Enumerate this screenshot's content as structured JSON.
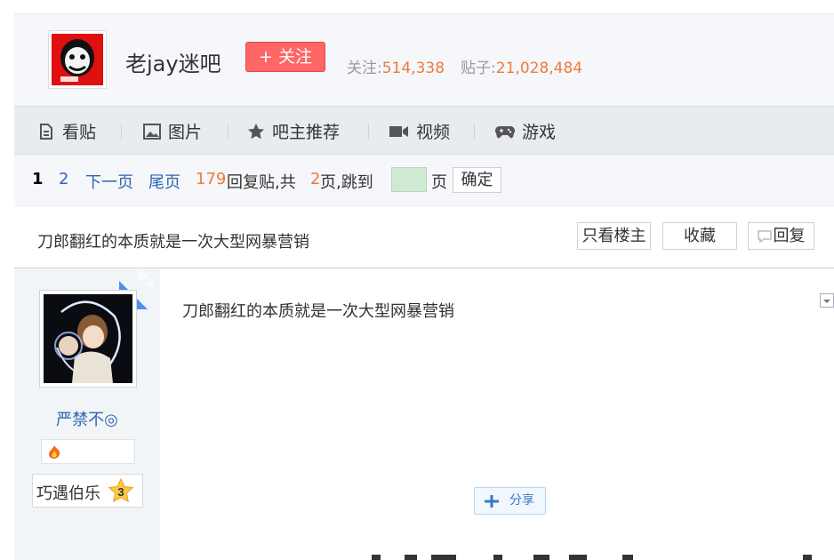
{
  "header": {
    "bar_name": "老jay迷吧",
    "follow_label": "+ 关注",
    "follow_count_label": "关注:",
    "follow_count": "514,338",
    "post_count_label": "贴子:",
    "post_count": "21,028,484"
  },
  "nav": {
    "items": [
      "看贴",
      "图片",
      "吧主推荐",
      "视频",
      "游戏"
    ]
  },
  "pager": {
    "current_page": "1",
    "page_2": "2",
    "next_label": "下一页",
    "last_label": "尾页",
    "reply_count": "179",
    "reply_suffix": "回复贴,共",
    "total_pages": "2",
    "pages_suffix": "页,跳到",
    "page_unit": "页",
    "confirm_label": "确定"
  },
  "thread": {
    "title": "刀郎翻红的本质就是一次大型网暴营销",
    "only_op_label": "只看楼主",
    "favorite_label": "收藏",
    "reply_label": "回复"
  },
  "post": {
    "op_tag": "楼主",
    "author_name": "严禁不◎",
    "level_title": "巧遇伯乐",
    "level_number": "3",
    "content": "刀郎翻红的本质就是一次大型网暴营销",
    "share_label": "分享"
  },
  "colors": {
    "follow_button": "#ff6666",
    "link_blue": "#2d64b3",
    "accent_orange": "#f07a39",
    "op_ribbon": "#4e8ef0"
  }
}
